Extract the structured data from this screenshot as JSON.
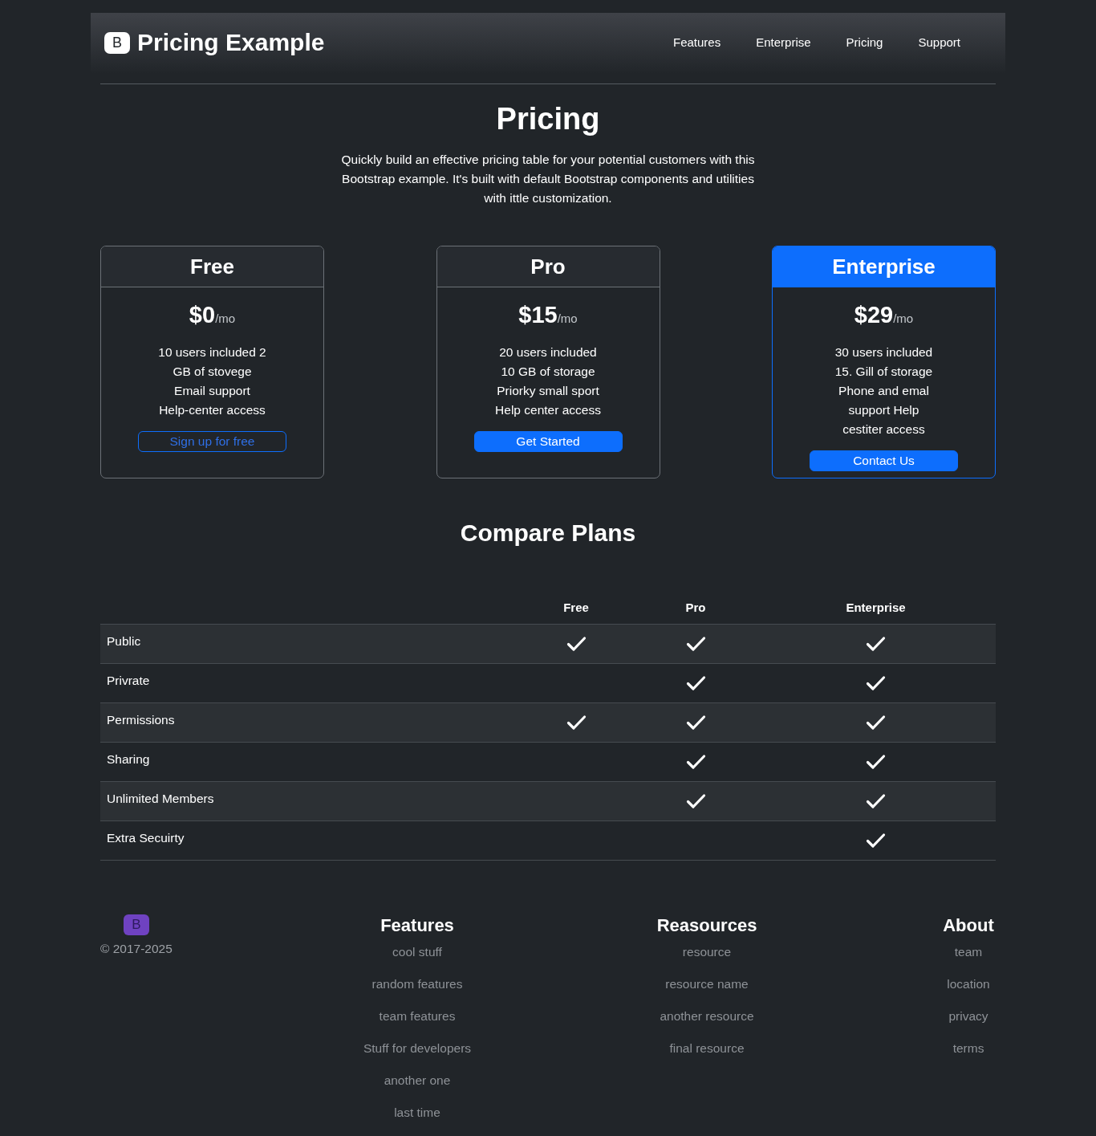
{
  "header": {
    "logo_letter": "B",
    "title": "Pricing Example",
    "nav": [
      "Features",
      "Enterprise",
      "Pricing",
      "Support"
    ]
  },
  "hero": {
    "title": "Pricing",
    "description": "Quickly build an effective pricing table for your potential customers with this Bootstrap example. It's built with default Bootstrap components and utilities with ittle customization."
  },
  "plans": [
    {
      "name": "Free",
      "highlighted": false,
      "price": "$0",
      "period": "/mo",
      "features": [
        "10 users included 2",
        "GB of stovege",
        "Email support",
        "Help-center access"
      ],
      "button": {
        "label": "Sign up for free",
        "kind": "outline"
      }
    },
    {
      "name": "Pro",
      "highlighted": false,
      "price": "$15",
      "period": "/mo",
      "features": [
        "20 users included",
        "10 GB of storage",
        "Priorky small sport",
        "Help center access"
      ],
      "button": {
        "label": "Get Started",
        "kind": "filled"
      }
    },
    {
      "name": "Enterprise",
      "highlighted": true,
      "price": "$29",
      "period": "/mo",
      "features": [
        "30 users included",
        "15. Gill of storage",
        "Phone and emal",
        "support Help",
        "cestiter access"
      ],
      "button": {
        "label": "Contact Us",
        "kind": "filled"
      }
    }
  ],
  "compare": {
    "title": "Compare Plans",
    "columns": [
      "Free",
      "Pro",
      "Enterprise"
    ],
    "rows": [
      {
        "label": "Public",
        "cells": [
          {
            "checked": true
          },
          {
            "checked": true
          },
          {
            "checked": true
          }
        ]
      },
      {
        "label": "Privrate",
        "cells": [
          {
            "checked": false
          },
          {
            "checked": true
          },
          {
            "checked": true
          }
        ]
      },
      {
        "label": "Permissions",
        "cells": [
          {
            "checked": true
          },
          {
            "checked": true
          },
          {
            "checked": true
          }
        ]
      },
      {
        "label": "Sharing",
        "cells": [
          {
            "checked": false
          },
          {
            "checked": true
          },
          {
            "checked": true
          }
        ]
      },
      {
        "label": "Unlimited Members",
        "cells": [
          {
            "checked": false
          },
          {
            "checked": true
          },
          {
            "checked": true
          }
        ]
      },
      {
        "label": "Extra Secuirty",
        "cells": [
          {
            "checked": false
          },
          {
            "checked": false
          },
          {
            "checked": true
          }
        ]
      }
    ]
  },
  "footer": {
    "logo_letter": "B",
    "copyright": "© 2017-2025",
    "columns": [
      {
        "title": "Features",
        "links": [
          "cool stuff",
          "random features",
          "team features",
          "Stuff for developers",
          "another one",
          "last time"
        ]
      },
      {
        "title": "Reasources",
        "links": [
          "resource",
          "resource name",
          "another resource",
          "final resource"
        ]
      },
      {
        "title": "About",
        "links": [
          "team",
          "location",
          "privacy",
          "terms"
        ]
      }
    ]
  }
}
